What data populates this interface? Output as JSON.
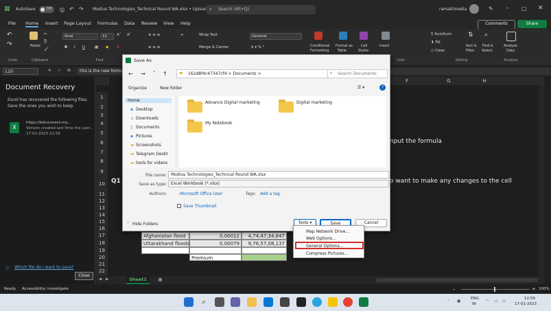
{
  "titlebar": {
    "autosave": "AutoSave",
    "autosave_state": "Off",
    "doc_title": "Modius Technologies_Technical Round WA.xlsx  •  Upload failed",
    "search_placeholder": "Search (Alt+Q)",
    "user": "ramaktmedia"
  },
  "tabs": [
    "File",
    "Home",
    "Insert",
    "Page Layout",
    "Formulas",
    "Data",
    "Review",
    "View",
    "Help"
  ],
  "active_tab": "Home",
  "buttons": {
    "comments": "Comments",
    "share": "Share"
  },
  "ribbon": {
    "paste": "Paste",
    "font_name": "Arial",
    "font_size": "12",
    "wrap_text": "Wrap Text",
    "merge_center": "Merge & Center",
    "number_format": "General",
    "conditional": "Conditional",
    "formatting": "Formatting",
    "format_as": "Format as",
    "table": "Table",
    "cell": "Cell",
    "styles": "Styles",
    "insert": "Insert",
    "autosum": "AutoSum",
    "fill": "Fill",
    "clear": "Clear",
    "sort_filter": "Sort &",
    "filter": "Filter",
    "find_select": "Find &",
    "select": "Select",
    "analyze": "Analyze",
    "data": "Data",
    "groups": {
      "undo": "Undo",
      "clipboard": "Clipboard",
      "font": "Font",
      "cells": "Cells",
      "editing": "Editing",
      "analysis": "Analysis"
    }
  },
  "formula_bar": {
    "name_box": "L10",
    "fx": "fx",
    "content": "this is the new formula"
  },
  "recovery": {
    "title": "Document Recovery",
    "desc1": "Excel has recovered the following files.",
    "desc2": "Save the ones you wish to keep.",
    "file_line1": "https://kiitconnect-my...",
    "file_line2": "Version created last time the user...",
    "file_line3": "17-01-2023 12:59",
    "which_file": "Which file do I want to save?",
    "close": "Close"
  },
  "grid": {
    "columns": [
      "F",
      "G",
      "H"
    ],
    "rows": [
      "1",
      "2",
      "3",
      "4",
      "5",
      "6",
      "7",
      "8",
      "9",
      "10",
      "11",
      "12",
      "13",
      "14",
      "15",
      "16",
      "17",
      "18",
      "19",
      "20",
      "21",
      "22"
    ],
    "q1": "Q1",
    "input_formula": "nput the formula",
    "want_changes": "o want to make any changes to the cell",
    "table": [
      [
        "Afghanistan flood",
        "0.00012",
        "4,74,47,34,847"
      ],
      [
        "Uttarakhand floods",
        "0.00079",
        "9,76,57,08,137"
      ]
    ],
    "premium": "Premium"
  },
  "sheet_tab": "Sheet1",
  "status": {
    "ready": "Ready",
    "accessibility": "Accessibility: Investigate",
    "zoom": "100%"
  },
  "dialog": {
    "title": "Save As",
    "path": "162d8f4c47347cf4  >  Documents  >",
    "search_placeholder": "Search Documents",
    "organize": "Organize",
    "new_folder": "New folder",
    "nav_items": [
      "Home",
      "Desktop",
      "Downloads",
      "Documents",
      "Pictures",
      "Screenshots",
      "Telegram Deskt",
      "tools for videos"
    ],
    "folders": [
      "Advance Digital marketing",
      "Digital marketing",
      "My Notebook"
    ],
    "file_name_label": "File name:",
    "file_name": "Modius Technologies_Technical Round WA.xlsx",
    "save_type_label": "Save as type:",
    "save_type": "Excel Workbook (*.xlsx)",
    "authors_label": "Authors:",
    "authors": "Microsoft Office User",
    "tags_label": "Tags:",
    "tags": "Add a tag",
    "save_thumbnail": "Save Thumbnail",
    "hide_folders": "Hide Folders",
    "tools": "Tools",
    "save": "Save",
    "cancel": "Cancel"
  },
  "tools_menu": [
    "Map Network Drive...",
    "Web Options...",
    "General Options...",
    "Compress Pictures..."
  ],
  "taskbar": {
    "lang1": "ENG",
    "lang2": "IN",
    "time": "12:59",
    "date": "17-01-2023"
  },
  "colors": {
    "excel_green": "#107c41",
    "accent_blue": "#0067c0",
    "highlight_red": "#d32f2f"
  }
}
